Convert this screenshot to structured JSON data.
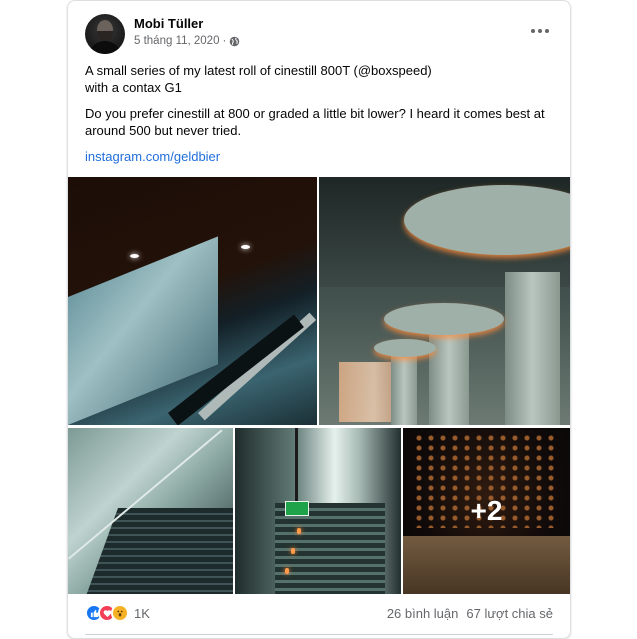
{
  "post": {
    "author": "Mobi Tüller",
    "date": "5 tháng 11, 2020",
    "privacy_icon": "globe-icon",
    "text": [
      "A small series of my latest roll of cinestill 800T (@boxspeed)\nwith a contax G1",
      "Do you prefer cinestill at 800 or graded a little bit lower? I heard it comes best at around 500 but never tried."
    ],
    "link": "instagram.com/geldbier",
    "more_photos": "+2"
  },
  "footer": {
    "reaction_icons": [
      "like-icon",
      "love-icon",
      "wow-icon"
    ],
    "reaction_count": "1K",
    "comments": "26 bình luận",
    "shares": "67 lượt chia sẻ"
  },
  "colors": {
    "link": "#216fdb",
    "like": "#1877f2",
    "love": "#f33e58",
    "wow": "#f7b125"
  }
}
